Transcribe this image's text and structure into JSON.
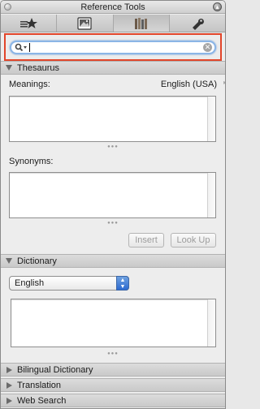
{
  "window": {
    "title": "Reference Tools"
  },
  "toolbar": {
    "tabs": [
      {
        "name": "star-icon"
      },
      {
        "name": "photo-icon"
      },
      {
        "name": "books-icon"
      },
      {
        "name": "wrench-icon"
      }
    ]
  },
  "search": {
    "value": "",
    "placeholder": ""
  },
  "thesaurus": {
    "title": "Thesaurus",
    "meanings_label": "Meanings:",
    "language": "English (USA)",
    "synonyms_label": "Synonyms:",
    "insert_label": "Insert",
    "lookup_label": "Look Up"
  },
  "dictionary": {
    "title": "Dictionary",
    "selected": "English"
  },
  "collapsed_sections": {
    "bilingual": "Bilingual Dictionary",
    "translation": "Translation",
    "web_search": "Web Search"
  },
  "colors": {
    "highlight_border": "#e2452a",
    "focus_ring": "#8bb5e6",
    "popup_accent": "#2d6ad1"
  }
}
